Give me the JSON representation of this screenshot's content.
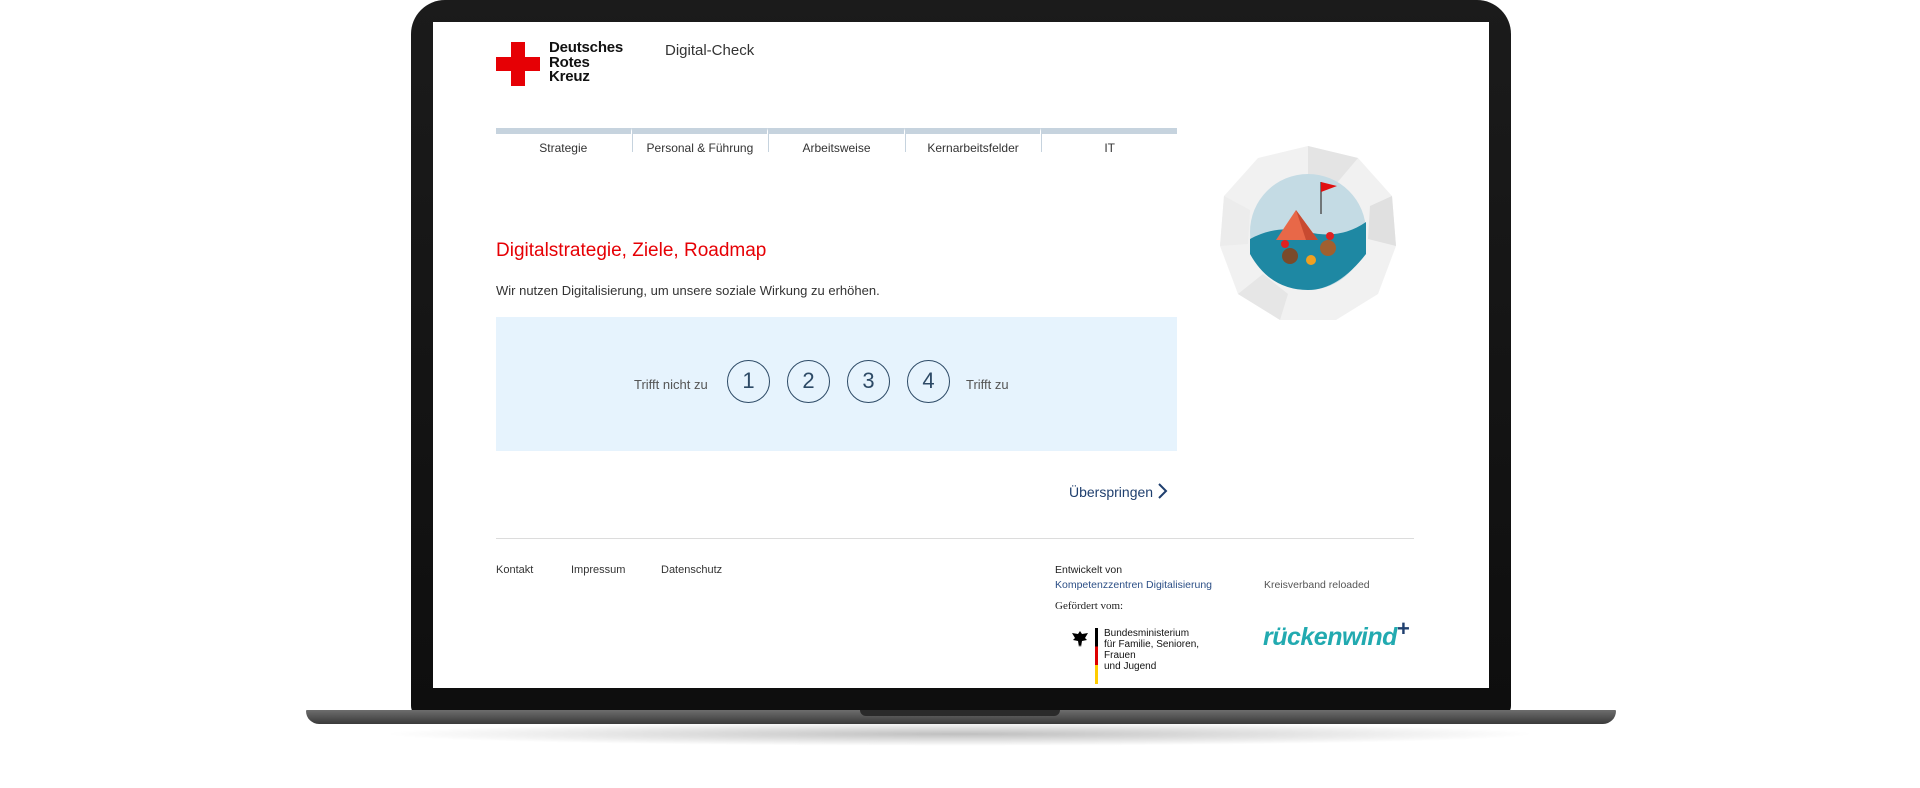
{
  "header": {
    "logo_line1": "Deutsches",
    "logo_line2": "Rotes",
    "logo_line3": "Kreuz",
    "app_title": "Digital-Check"
  },
  "tabs": [
    {
      "label": "Strategie"
    },
    {
      "label": "Personal & Führung"
    },
    {
      "label": "Arbeitsweise"
    },
    {
      "label": "Kernarbeitsfelder"
    },
    {
      "label": "IT"
    }
  ],
  "question": {
    "title": "Digitalstrategie, Ziele, Roadmap",
    "text": "Wir nutzen Digitalisierung, um unsere soziale Wirkung zu erhöhen.",
    "scale_low": "Trifft nicht zu",
    "scale_high": "Trifft zu",
    "options": [
      "1",
      "2",
      "3",
      "4"
    ]
  },
  "skip": {
    "label": "Überspringen",
    "icon": "chevron-right-icon"
  },
  "footer": {
    "links": [
      "Kontakt",
      "Impressum",
      "Datenschutz"
    ],
    "developed_by_label": "Entwickelt von",
    "developed_by_link": "Kompetenzzentren Digitalisierung",
    "partner": "Kreisverband reloaded",
    "funded_label": "Gefördert vom:",
    "ministry_line1": "Bundesministerium",
    "ministry_line2": "für Familie, Senioren, Frauen",
    "ministry_line3": "und Jugend",
    "rw_logo": "rückenwind",
    "rw_plus": "+"
  },
  "colors": {
    "brand_red": "#e60005",
    "accent_blue": "#2d4a66",
    "answer_bg": "#e6f3fd",
    "tab_bar": "#c6d3de",
    "rw_teal": "#22aab0"
  }
}
